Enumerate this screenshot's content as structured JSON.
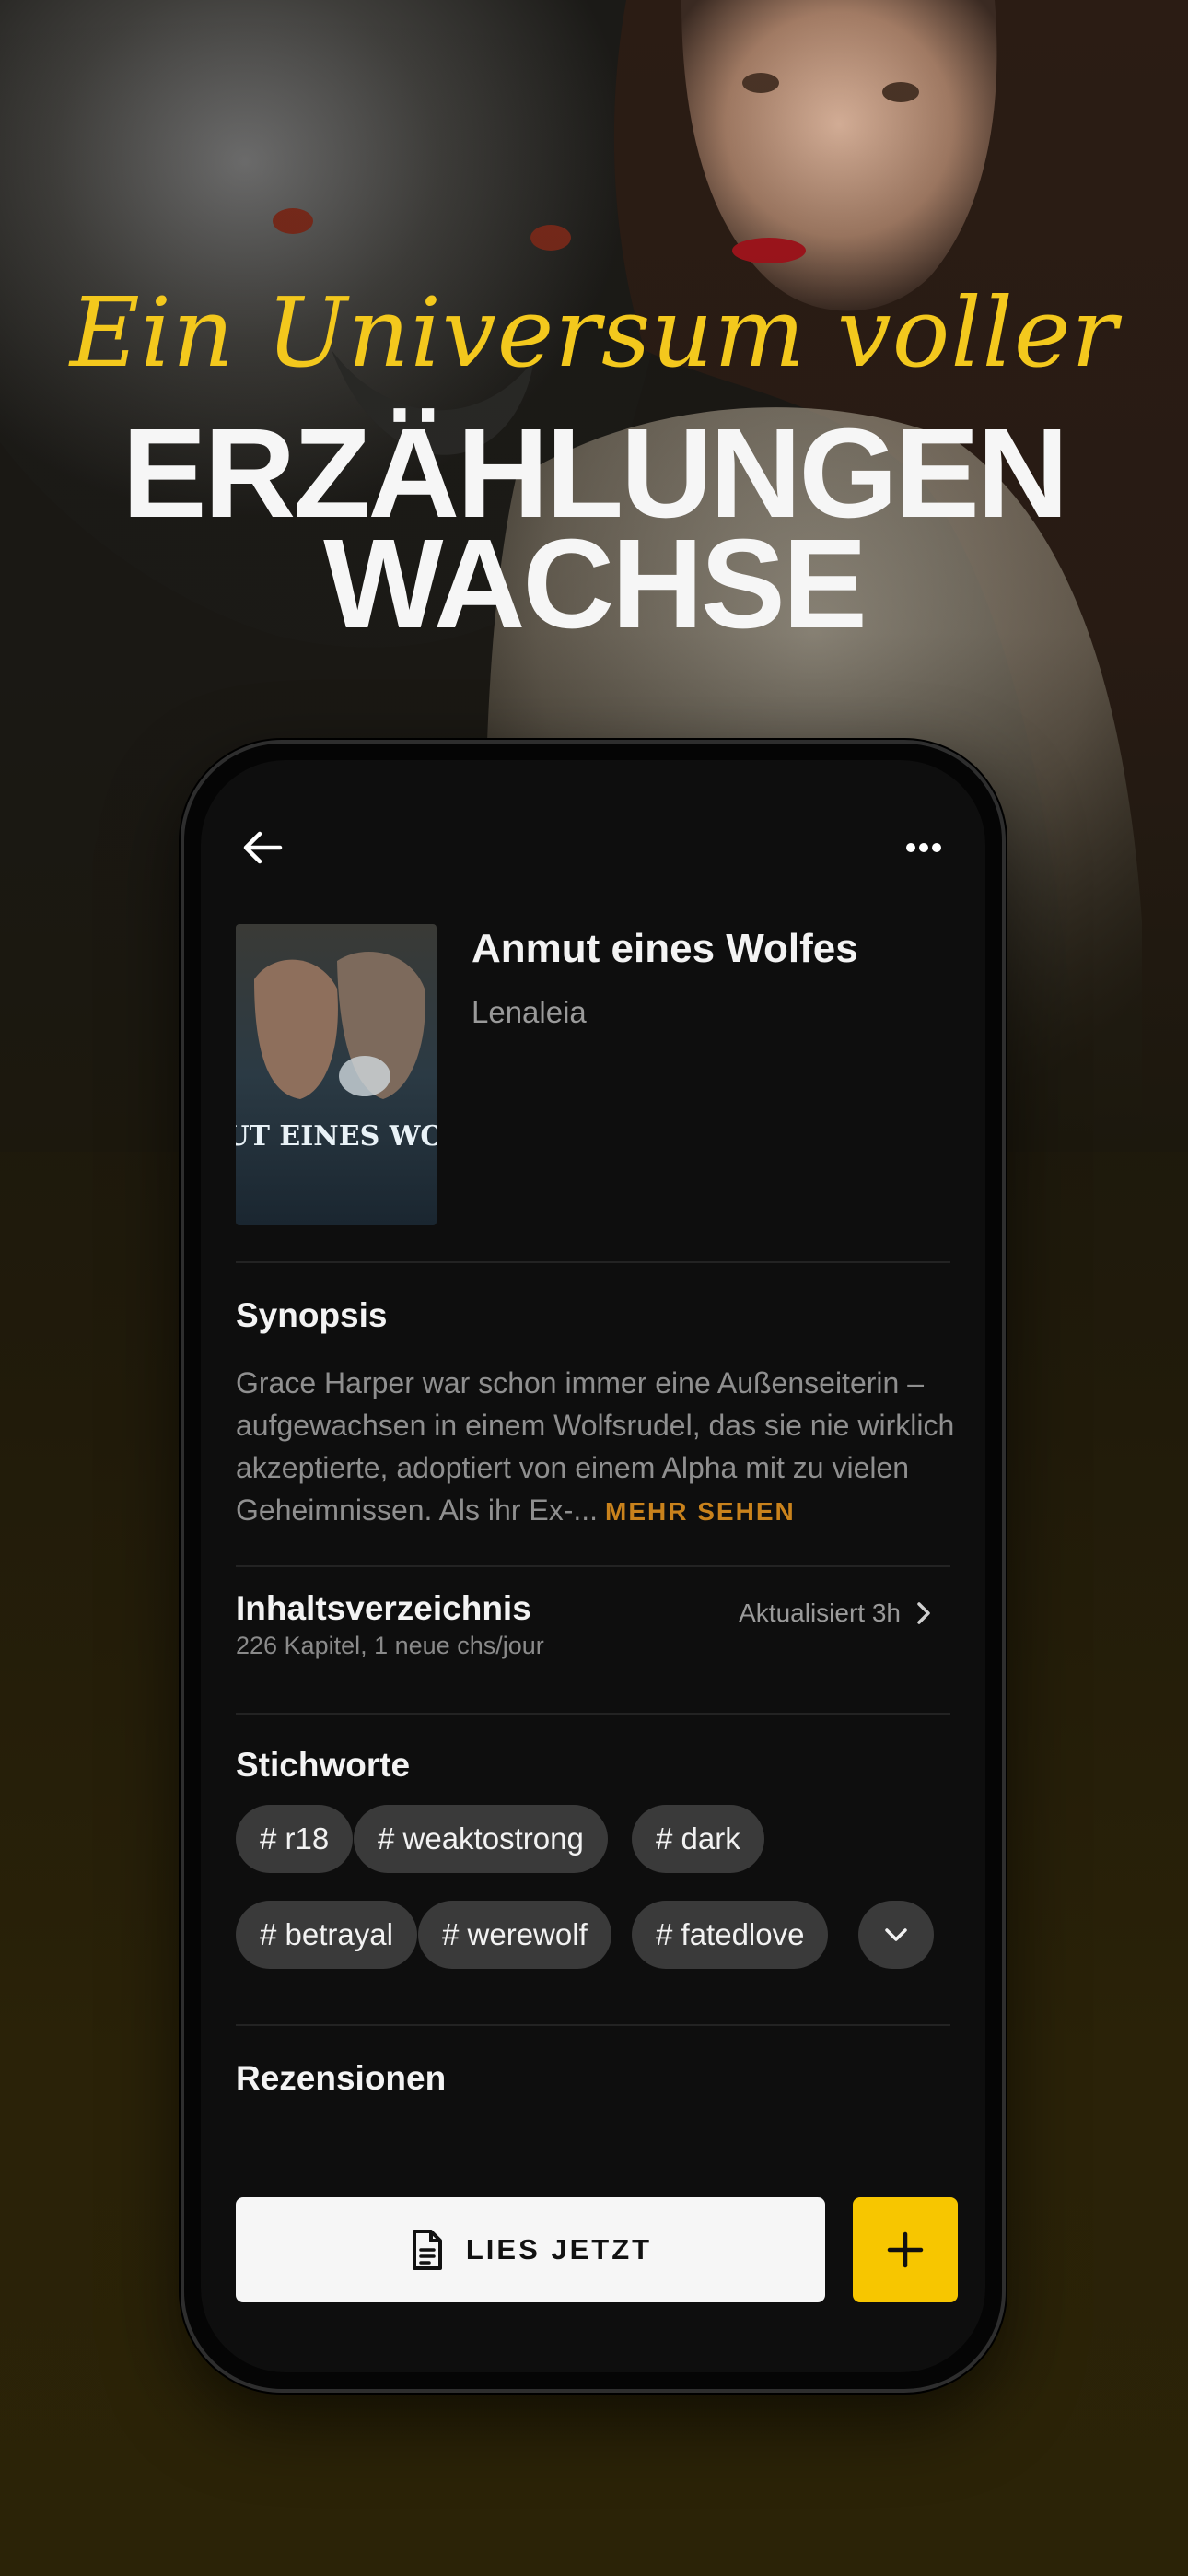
{
  "promo": {
    "script_line": "Ein Universum voller",
    "headline_line1": "ERZÄHLUNGEN",
    "headline_line2": "WACHSE"
  },
  "book": {
    "title": "Anmut eines Wolfes",
    "author": "Lenaleia",
    "cover_text": "ANMUT EINES WOLFES"
  },
  "synopsis": {
    "heading": "Synopsis",
    "text": "Grace Harper war schon immer eine Außenseiterin – aufgewachsen in einem Wolfsrudel, das sie nie wirklich akzeptierte, adoptiert von einem Alpha mit zu vielen Geheimnissen. Als ihr Ex-...",
    "more_label": "MEHR SEHEN"
  },
  "toc": {
    "heading": "Inhaltsverzeichnis",
    "subtitle": "226 Kapitel, 1 neue chs/jour",
    "updated": "Aktualisiert 3h"
  },
  "tags": {
    "heading": "Stichworte",
    "items": [
      "# r18",
      "# weaktostrong",
      "# dark",
      "# betrayal",
      "# werewolf",
      "# fatedlove"
    ]
  },
  "reviews": {
    "heading": "Rezensionen"
  },
  "actions": {
    "read_label": "LIES JETZT"
  },
  "colors": {
    "accent_yellow": "#f7c600",
    "more_link": "#c9821c",
    "script_yellow": "#f3c81d",
    "screen_bg": "#0e0e0e"
  },
  "icons": {
    "back": "arrow-left-icon",
    "more": "more-horizontal-icon",
    "chevron": "chevron-right-icon",
    "expand": "chevron-down-icon",
    "document": "document-icon",
    "add": "plus-icon"
  }
}
